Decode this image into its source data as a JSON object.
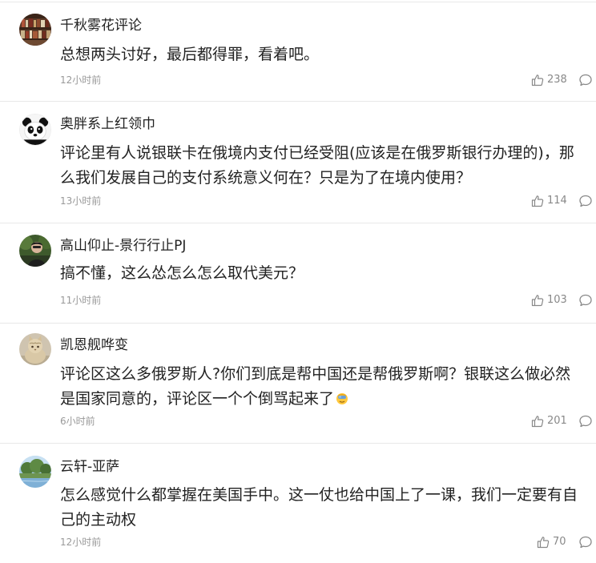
{
  "comments": [
    {
      "user": "千秋雾花评论",
      "text": "总想两头讨好，最后都得罪，看着吧。",
      "time": "12小时前",
      "likes": "238",
      "avatar": "bookshelf-avatar"
    },
    {
      "user": "奥胖系上红领巾",
      "text": "评论里有人说银联卡在俄境内支付已经受阻(应该是在俄罗斯银行办理的)，那么我们发展自己的支付系统意义何在？只是为了在境内使用？",
      "time": "13小时前",
      "likes": "114",
      "avatar": "panda-avatar"
    },
    {
      "user": "高山仰止-景行行止PJ",
      "text": "搞不懂，这么怂怎么怎么取代美元？",
      "time": "11小时前",
      "likes": "103",
      "avatar": "portrait-avatar"
    },
    {
      "user": "凯恩舰哗变",
      "text": "评论区这么多俄罗斯人?你们到底是帮中国还是帮俄罗斯啊？银联这么做必然是国家同意的，评论区一个个倒骂起来了",
      "time": "6小时前",
      "likes": "201",
      "avatar": "cat-avatar",
      "emoji": "facepalm-emoji"
    },
    {
      "user": "云轩-亚萨",
      "text": "怎么感觉什么都掌握在美国手中。这一仗也给中国上了一课，我们一定要有自己的主动权",
      "time": "12小时前",
      "likes": "70",
      "avatar": "landscape-avatar"
    }
  ],
  "icons": {
    "like": "thumbs-up-icon",
    "reply": "comment-bubble-icon"
  },
  "colors": {
    "text": "#222222",
    "meta": "#999999",
    "divider": "#e8e8e8"
  }
}
